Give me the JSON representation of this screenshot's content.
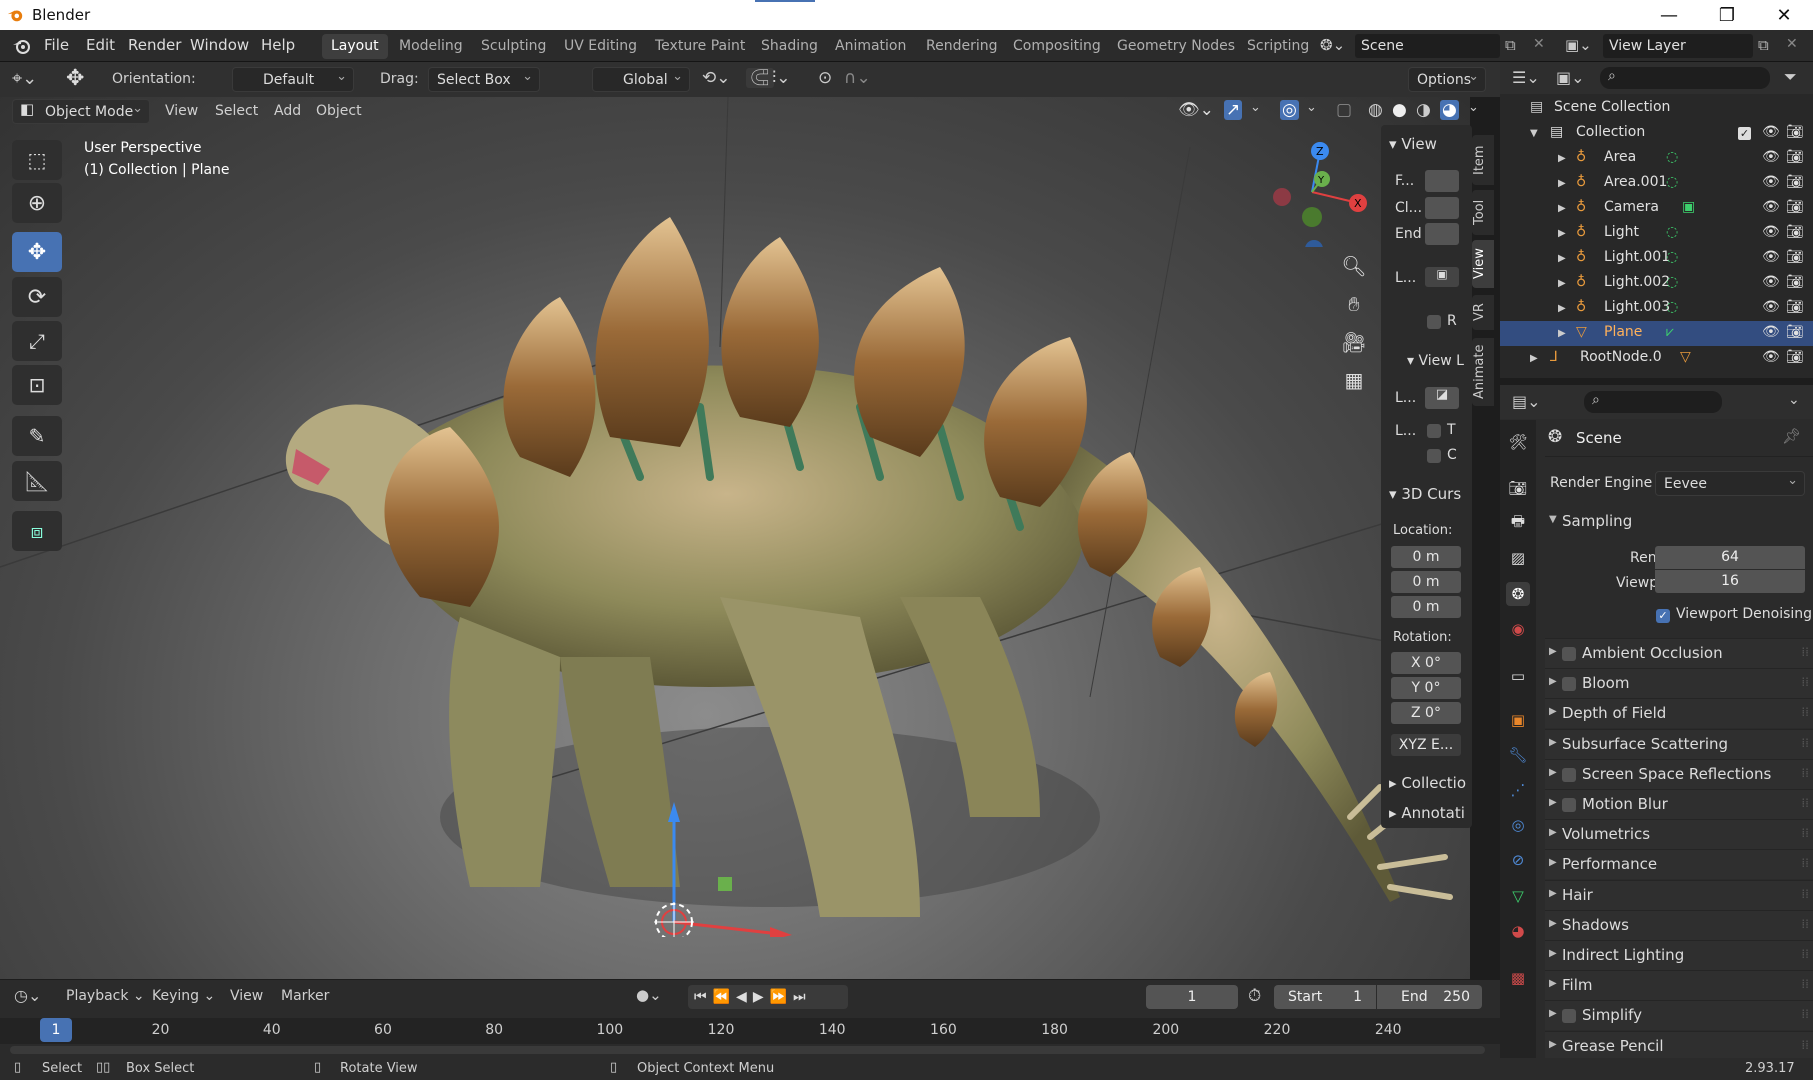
{
  "window": {
    "title": "Blender",
    "version": "2.93.17"
  },
  "menu": [
    "File",
    "Edit",
    "Render",
    "Window",
    "Help"
  ],
  "workspaces": [
    "Layout",
    "Modeling",
    "Sculpting",
    "UV Editing",
    "Texture Paint",
    "Shading",
    "Animation",
    "Rendering",
    "Compositing",
    "Geometry Nodes",
    "Scripting"
  ],
  "active_workspace": "Layout",
  "scene_name": "Scene",
  "view_layer": "View Layer",
  "tool_header": {
    "orientation_label": "Orientation:",
    "orientation_value": "Default",
    "drag_label": "Drag:",
    "drag_value": "Select Box",
    "transform_space": "Global",
    "options": "Options"
  },
  "view_header": {
    "mode": "Object Mode",
    "items": [
      "View",
      "Select",
      "Add",
      "Object"
    ]
  },
  "viewport": {
    "perspective": "User Perspective",
    "collection_info": "(1) Collection | Plane"
  },
  "npanel": {
    "view_header": "View",
    "f_label": "F...",
    "cl_label": "Cl...",
    "end_label": "End",
    "l_label": "L...",
    "r_label": "R",
    "view_lock_header": "View L",
    "l2_label": "L...",
    "l3_label": "L...",
    "t_label": "T",
    "c_label": "C",
    "cursor_header": "3D Curs",
    "location_label": "Location:",
    "loc": [
      "0 m",
      "0 m",
      "0 m"
    ],
    "rotation_label": "Rotation:",
    "rot": [
      "X  0°",
      "Y  0°",
      "Z  0°"
    ],
    "rot_mode": "XYZ E...",
    "collection": "Collectio",
    "annotations": "Annotati",
    "tabs": [
      "Item",
      "Tool",
      "View",
      "VR",
      "Animate"
    ]
  },
  "outliner": {
    "scene_collection": "Scene Collection",
    "collection": "Collection",
    "items": [
      {
        "name": "Area",
        "type": "light"
      },
      {
        "name": "Area.001",
        "type": "light"
      },
      {
        "name": "Camera",
        "type": "camera"
      },
      {
        "name": "Light",
        "type": "light"
      },
      {
        "name": "Light.001",
        "type": "light"
      },
      {
        "name": "Light.002",
        "type": "light"
      },
      {
        "name": "Light.003",
        "type": "light"
      },
      {
        "name": "Plane",
        "type": "mesh",
        "selected": true
      }
    ],
    "root_node": "RootNode.0"
  },
  "properties": {
    "context": "Scene",
    "render_engine_label": "Render Engine",
    "render_engine": "Eevee",
    "sampling": "Sampling",
    "render_label": "Render",
    "render_value": "64",
    "viewport_label": "Viewport",
    "viewport_value": "16",
    "denoising": "Viewport Denoising",
    "sections": [
      {
        "label": "Ambient Occlusion",
        "checkbox": true
      },
      {
        "label": "Bloom",
        "checkbox": true
      },
      {
        "label": "Depth of Field",
        "checkbox": false
      },
      {
        "label": "Subsurface Scattering",
        "checkbox": false
      },
      {
        "label": "Screen Space Reflections",
        "checkbox": true
      },
      {
        "label": "Motion Blur",
        "checkbox": true
      },
      {
        "label": "Volumetrics",
        "checkbox": false
      },
      {
        "label": "Performance",
        "checkbox": false
      },
      {
        "label": "Hair",
        "checkbox": false
      },
      {
        "label": "Shadows",
        "checkbox": false
      },
      {
        "label": "Indirect Lighting",
        "checkbox": false
      },
      {
        "label": "Film",
        "checkbox": false
      },
      {
        "label": "Simplify",
        "checkbox": true
      },
      {
        "label": "Grease Pencil",
        "checkbox": false
      }
    ]
  },
  "timeline": {
    "menus": [
      "Playback",
      "Keying",
      "View",
      "Marker"
    ],
    "current_frame": "1",
    "start_label": "Start",
    "start": "1",
    "end_label": "End",
    "end": "250",
    "ticks": [
      "1",
      "20",
      "40",
      "60",
      "80",
      "100",
      "120",
      "140",
      "160",
      "180",
      "200",
      "220",
      "240"
    ]
  },
  "status": {
    "select": "Select",
    "box_select": "Box Select",
    "rotate": "Rotate View",
    "context": "Object Context Menu"
  },
  "colors": {
    "accent": "#4772b3",
    "selection": "#334d80",
    "bg": "#2b2b2b"
  }
}
